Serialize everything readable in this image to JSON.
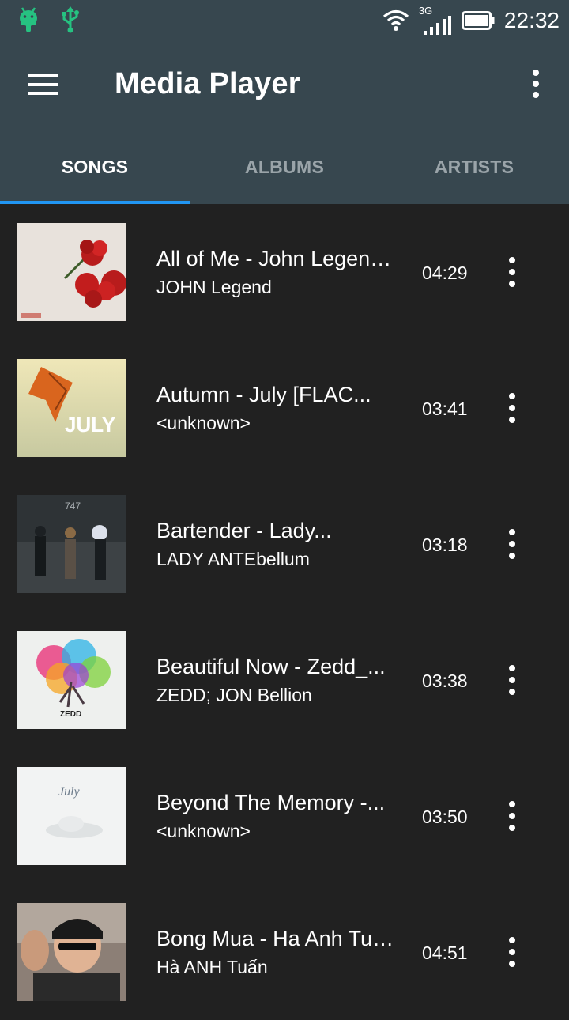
{
  "status_bar": {
    "time": "22:32",
    "network": "3G",
    "icons": [
      "android-icon",
      "usb-icon",
      "wifi-icon",
      "signal-icon",
      "battery-icon"
    ]
  },
  "app_bar": {
    "title": "Media Player",
    "icons": [
      "menu-icon",
      "more-vert-icon"
    ]
  },
  "tabs": [
    {
      "label": "SONGS",
      "active": true
    },
    {
      "label": "ALBUMS",
      "active": false
    },
    {
      "label": "ARTISTS",
      "active": false
    }
  ],
  "songs": [
    {
      "title": "All of Me - John Legend...",
      "artist": "JOHN Legend",
      "duration": "04:29"
    },
    {
      "title": "Autumn - July [FLAC...",
      "artist": "<unknown>",
      "duration": "03:41"
    },
    {
      "title": "Bartender - Lady...",
      "artist": "LADY ANTEbellum",
      "duration": "03:18"
    },
    {
      "title": "Beautiful Now - Zedd_...",
      "artist": "ZEDD; JON Bellion",
      "duration": "03:38"
    },
    {
      "title": "Beyond The Memory -...",
      "artist": "<unknown>",
      "duration": "03:50"
    },
    {
      "title": "Bong Mua - Ha Anh Tua...",
      "artist": "Hà ANH Tuấn",
      "duration": "04:51"
    }
  ],
  "album_art": {
    "autumn_text": "JULY",
    "bartender_text": "747",
    "zedd_text": "ZEDD",
    "beyond_text": "July"
  },
  "colors": {
    "app_bar": "#37474f",
    "background": "#212121",
    "accent": "#2196f3",
    "inactive_tab": "#9aa4a9"
  }
}
